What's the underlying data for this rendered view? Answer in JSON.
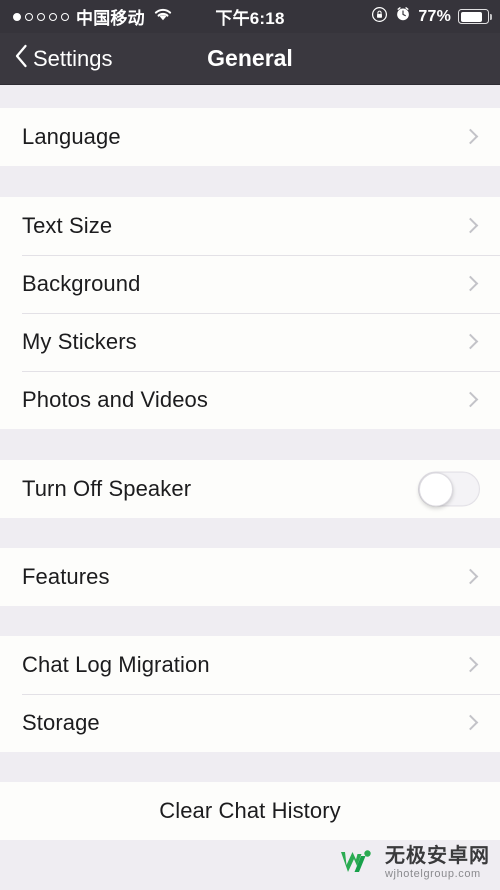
{
  "status_bar": {
    "signal_dots_total": 5,
    "signal_dots_filled": 1,
    "carrier": "中国移动",
    "wifi_icon": "wifi-icon",
    "time": "下午6:18",
    "rotation_lock_icon": "rotation-lock-icon",
    "alarm_icon": "alarm-clock-icon",
    "battery_percent": "77%",
    "battery_icon": "battery-icon"
  },
  "nav": {
    "back_icon": "chevron-left-icon",
    "back_label": "Settings",
    "title": "General"
  },
  "sections": [
    {
      "rows": [
        {
          "label": "Language",
          "accessory": "chevron"
        }
      ]
    },
    {
      "rows": [
        {
          "label": "Text Size",
          "accessory": "chevron"
        },
        {
          "label": "Background",
          "accessory": "chevron"
        },
        {
          "label": "My Stickers",
          "accessory": "chevron"
        },
        {
          "label": "Photos and Videos",
          "accessory": "chevron"
        }
      ]
    },
    {
      "rows": [
        {
          "label": "Turn Off Speaker",
          "accessory": "switch",
          "switch_on": false
        }
      ]
    },
    {
      "rows": [
        {
          "label": "Features",
          "accessory": "chevron"
        }
      ]
    },
    {
      "rows": [
        {
          "label": "Chat Log Migration",
          "accessory": "chevron"
        },
        {
          "label": "Storage",
          "accessory": "chevron"
        }
      ]
    },
    {
      "rows": [
        {
          "label": "Clear Chat History",
          "accessory": "none",
          "centered": true
        }
      ]
    }
  ],
  "watermark": {
    "logo_icon": "w-logo-icon",
    "name_cn": "无极安卓网",
    "url": "wjhotelgroup.com",
    "brand_color": "#2bab52"
  },
  "colors": {
    "navbar_bg": "#3a383f",
    "statusbar_bg": "#36343b",
    "page_bg": "#efedf2",
    "row_bg": "#fdfdfb",
    "separator": "#e3e1e6",
    "chevron": "#c3c3c8",
    "text": "#1c1c1e"
  }
}
